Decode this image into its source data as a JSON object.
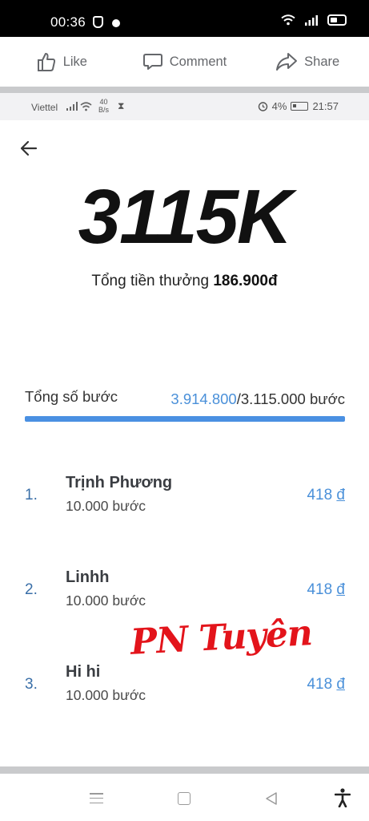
{
  "status_bar": {
    "time": "00:36"
  },
  "facebook_actions": {
    "like": "Like",
    "comment": "Comment",
    "share": "Share"
  },
  "inner_status_bar": {
    "carrier": "Viettel",
    "speed_value": "40",
    "speed_unit": "B/s",
    "battery": "4%",
    "time": "21:57"
  },
  "summary": {
    "total_steps_display": "3115K",
    "reward_label": "Tổng tiền thưởng",
    "reward_value": "186.900đ"
  },
  "progress": {
    "label": "Tổng số bước",
    "current": "3.914.800",
    "separator": "/",
    "target": "3.115.000 bước",
    "fill_fraction": 1.0
  },
  "leaderboard": [
    {
      "rank": "1.",
      "name": "Trịnh Phương",
      "steps": "10.000 bước",
      "amount": "418",
      "currency": "đ"
    },
    {
      "rank": "2.",
      "name": "Linhh",
      "steps": "10.000 bước",
      "amount": "418",
      "currency": "đ"
    },
    {
      "rank": "3.",
      "name": "Hi hi",
      "steps": "10.000 bước",
      "amount": "418",
      "currency": "đ"
    }
  ],
  "watermark": "PN Tuyên",
  "colors": {
    "accent": "#4a90e2",
    "watermark": "#e3141b",
    "rank": "#3a6fa8"
  }
}
